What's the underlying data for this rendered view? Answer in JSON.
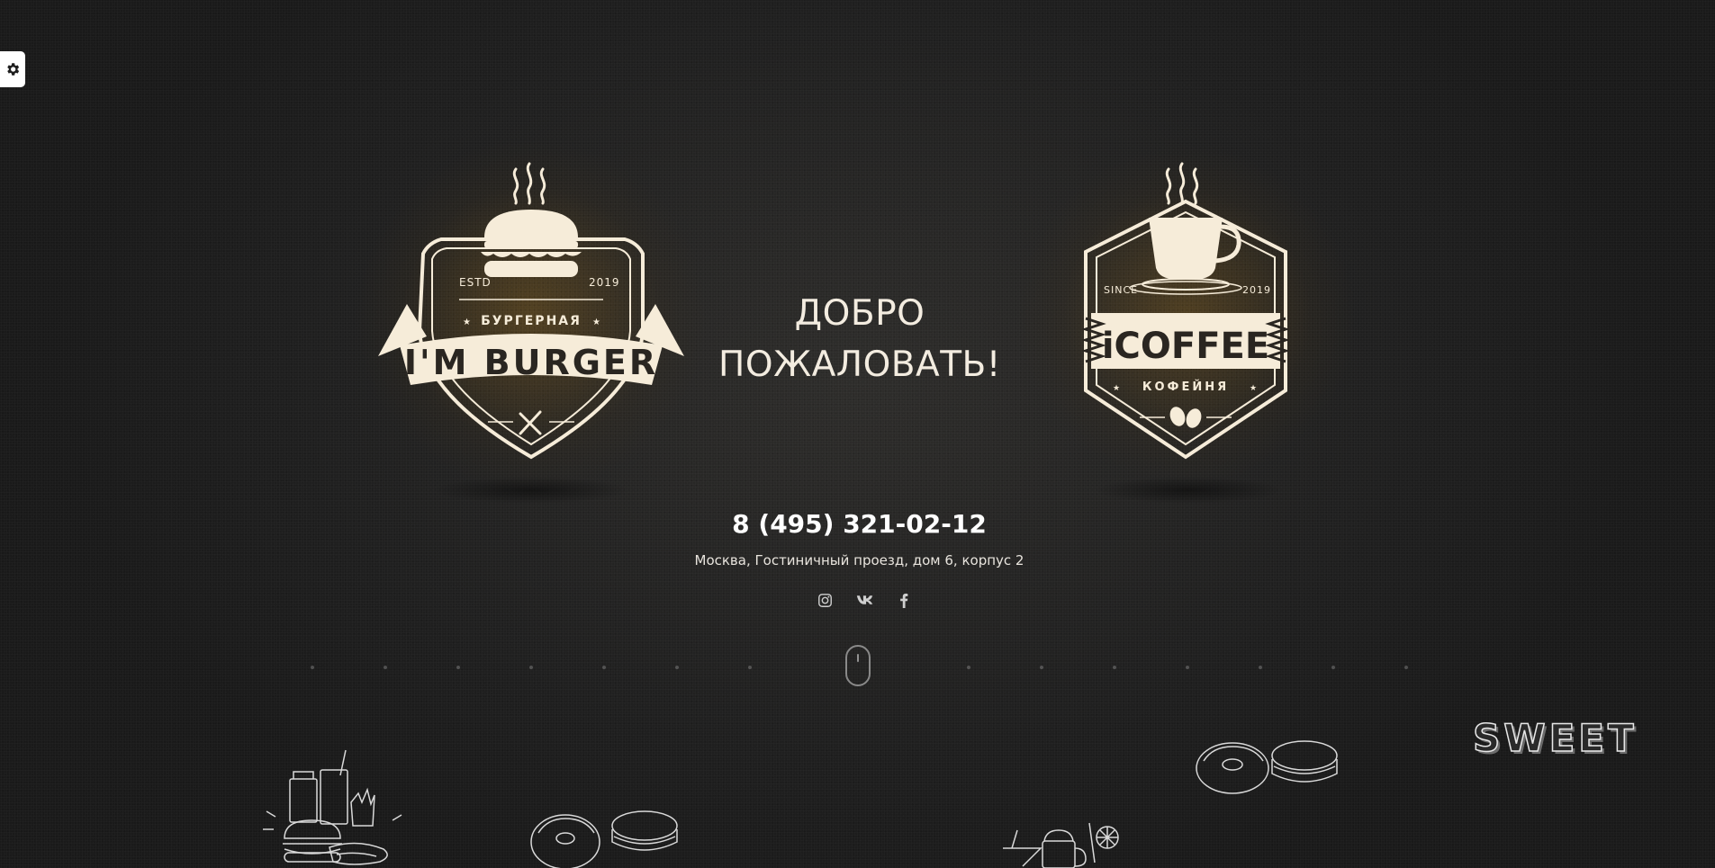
{
  "settings": {
    "icon": "gear-icon"
  },
  "burger_logo": {
    "estd": "ESTD",
    "year": "2019",
    "subtitle": "БУРГЕРНАЯ",
    "name": "I'M BURGER"
  },
  "coffee_logo": {
    "since": "SINCE",
    "year": "2019",
    "name": "iCOFFEE",
    "subtitle": "КОФЕЙНЯ"
  },
  "welcome": {
    "line1": "ДОБРО",
    "line2": "ПОЖАЛОВАТЬ!"
  },
  "contact": {
    "phone": "8 (495) 321-02-12",
    "address": "Москва, Гостиничный проезд, дом 6, корпус 2"
  },
  "socials": [
    {
      "icon": "instagram-icon"
    },
    {
      "icon": "vk-icon"
    },
    {
      "icon": "facebook-icon"
    }
  ],
  "scroll": {
    "icon": "mouse-scroll-icon"
  },
  "decor": {
    "sweet_label": "SWEET"
  },
  "colors": {
    "background": "#222222",
    "logo_cream": "#f6ecd9",
    "glow": "#785a1e",
    "text": "#ffffff"
  }
}
